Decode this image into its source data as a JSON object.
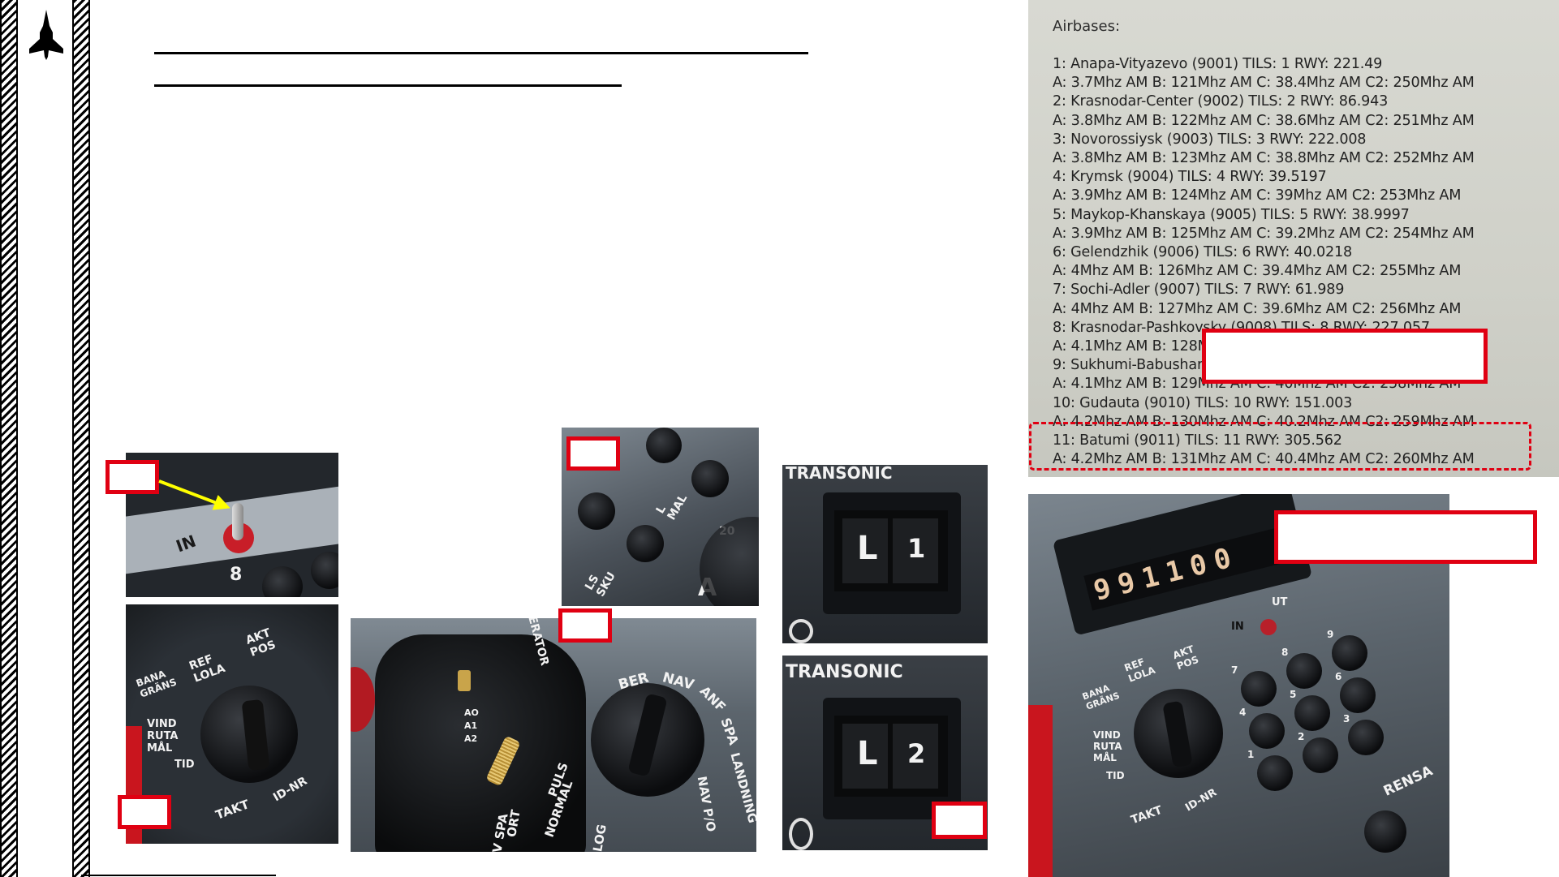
{
  "airbases_doc": {
    "title": "Airbases:",
    "entries": [
      "1: Anapa-Vityazevo (9001) TILS: 1 RWY: 221.49",
      "A: 3.7Mhz AM B: 121Mhz AM C: 38.4Mhz AM C2: 250Mhz AM",
      "2: Krasnodar-Center (9002) TILS: 2 RWY: 86.943",
      "A: 3.8Mhz AM B: 122Mhz AM C: 38.6Mhz AM C2: 251Mhz AM",
      "3: Novorossiysk (9003) TILS: 3 RWY: 222.008",
      "A: 3.8Mhz AM B: 123Mhz AM C: 38.8Mhz AM C2: 252Mhz AM",
      "4: Krymsk (9004) TILS: 4 RWY: 39.5197",
      "A: 3.9Mhz AM B: 124Mhz AM C: 39Mhz AM C2: 253Mhz AM",
      "5: Maykop-Khanskaya (9005) TILS: 5 RWY: 38.9997",
      "A: 3.9Mhz AM B: 125Mhz AM C: 39.2Mhz AM C2: 254Mhz AM",
      "6: Gelendzhik (9006) TILS: 6 RWY: 40.0218",
      "A: 4Mhz AM B: 126Mhz AM C: 39.4Mhz AM C2: 255Mhz AM",
      "7: Sochi-Adler (9007) TILS: 7 RWY: 61.989",
      "A: 4Mhz AM B: 127Mhz AM C: 39.6Mhz AM C2: 256Mhz AM",
      "8: Krasnodar-Pashkovsky (9008) TILS: 8 RWY: 227.057",
      "A: 4.1Mhz AM B: 128Mhz AM C: 39.8Mhz AM C2: 257Mhz AM",
      "9: Sukhumi-Babushara (9009) TILS: 9 RWY: 241.5",
      "A: 4.1Mhz AM B: 129Mhz AM C: 40Mhz AM C2: 258Mhz AM",
      "10: Gudauta (9010) TILS: 10 RWY: 151.003",
      "A: 4.2Mhz AM B: 130Mhz AM C: 40.2Mhz AM C2: 259Mhz AM",
      "11: Batumi (9011) TILS: 11 RWY: 305.562",
      "A: 4.2Mhz AM B: 131Mhz AM C: 40.4Mhz AM C2: 260Mhz AM"
    ]
  },
  "panel_io": {
    "in": "IN",
    "digit": "8"
  },
  "panel_nav_mode": {
    "label_lmal": "L MAL",
    "label_lssku": "LS SKU",
    "label_20": "20",
    "label_a": "A"
  },
  "tils_display_1": {
    "header": "TRANSONIC",
    "letter": "L",
    "digit": "1"
  },
  "tils_display_2": {
    "header": "TRANSONIC",
    "letter": "L",
    "digit": "2"
  },
  "selector_panel": {
    "labels": [
      "BANA GRÄNS",
      "REF LOLA",
      "AKT POS",
      "VIND RUTA MÅL",
      "TID",
      "TAKT",
      "ID-NR"
    ]
  },
  "master_mode_panel": {
    "labels": [
      "ERATOR",
      "BER",
      "NAV",
      "ANF",
      "SPA",
      "LANDNING",
      "NAV P/O",
      "PULS",
      "NORMAL",
      "ORT",
      "V SPA",
      "LOG"
    ],
    "lever_labels": [
      "AO",
      "A1",
      "A2"
    ]
  },
  "datapanel": {
    "readout": "991100",
    "ut": "UT",
    "in": "IN",
    "rensa": "RENSA",
    "keys": [
      "1",
      "2",
      "3",
      "4",
      "5",
      "6",
      "7",
      "8",
      "9"
    ],
    "labels": [
      "BANA GRÄNS",
      "REF LOLA",
      "AKT POS",
      "VIND RUTA MÅL",
      "TID",
      "TAKT",
      "ID-NR"
    ]
  },
  "colors": {
    "callout": "#e00012",
    "arrow": "#ffff00"
  }
}
